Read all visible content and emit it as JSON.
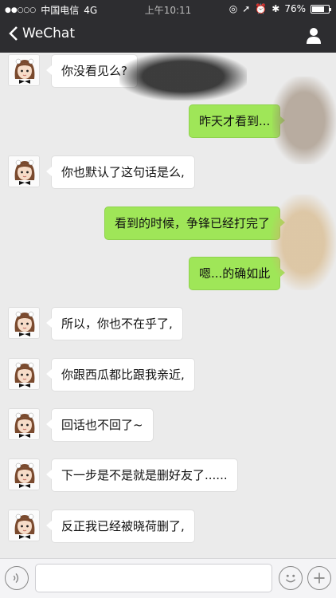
{
  "status": {
    "carrier": "中国电信",
    "network": "4G",
    "time": "上午10:11",
    "battery": "76%",
    "battery_level": 0.76
  },
  "nav": {
    "back_label": "WeChat",
    "icons": {
      "back": "chevron-left-icon",
      "profile": "person-icon"
    }
  },
  "messages": [
    {
      "side": "in",
      "text": "你没看见么?"
    },
    {
      "side": "out",
      "text": "昨天才看到..."
    },
    {
      "side": "in",
      "text": "你也默认了这句话是么,"
    },
    {
      "side": "out",
      "text": "看到的时候，争锋已经打完了"
    },
    {
      "side": "out",
      "text": "嗯...的确如此"
    },
    {
      "side": "in",
      "text": "所以，你也不在乎了,"
    },
    {
      "side": "in",
      "text": "你跟西瓜都比跟我亲近,"
    },
    {
      "side": "in",
      "text": "回话也不回了~"
    },
    {
      "side": "in",
      "text": "下一步是不是就是删好友了......"
    },
    {
      "side": "in",
      "text": "反正我已经被晓荷删了,"
    }
  ],
  "input": {
    "value": "",
    "icons": {
      "voice": "voice-icon",
      "emoji": "emoji-icon",
      "more": "plus-icon"
    }
  }
}
